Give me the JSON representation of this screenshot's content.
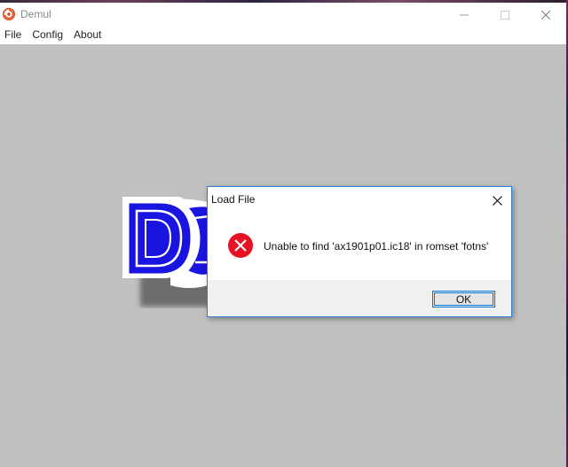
{
  "window": {
    "title": "Demul",
    "icon": "dreamcast-swirl-icon",
    "controls": [
      "minimize-icon",
      "maximize-icon",
      "close-icon"
    ]
  },
  "menu": {
    "items": [
      {
        "label": "File"
      },
      {
        "label": "Config"
      },
      {
        "label": "About"
      }
    ]
  },
  "dialog": {
    "title": "Load File",
    "message": "Unable to find 'ax1901p01.ic18' in romset 'fotns'",
    "icon": "error-icon",
    "ok_label": "OK"
  },
  "colors": {
    "client_background": "#c0c0c0",
    "logo_blue": "#1a14e0",
    "error_red": "#e81123",
    "dialog_border": "#2c7bd6",
    "button_focus": "#0078d7"
  }
}
